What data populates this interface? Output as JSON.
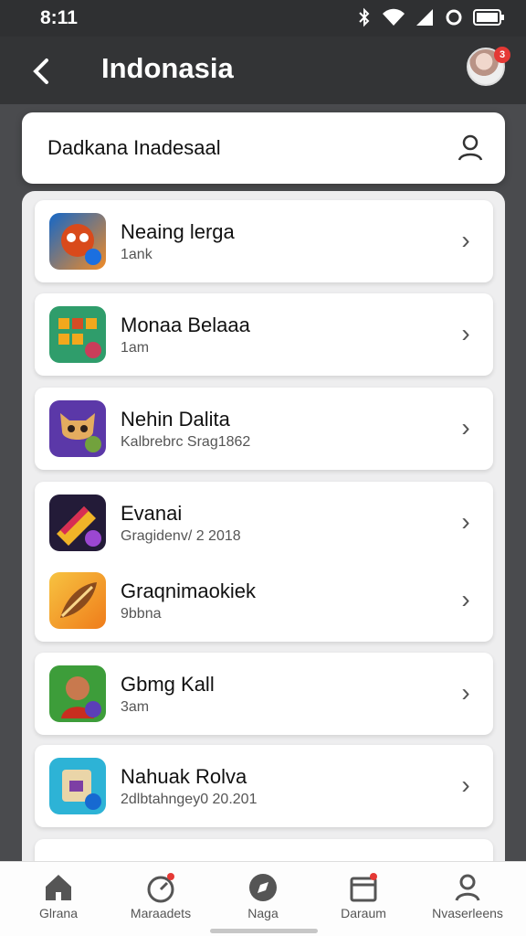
{
  "status_bar": {
    "time": "8:11"
  },
  "header": {
    "title": "Indonasia",
    "back_icon": "arrow-left-icon",
    "avatar_badge": "3"
  },
  "search": {
    "value": "Dadkana Inadesaal",
    "placeholder": "",
    "icon": "user-icon"
  },
  "apps": [
    {
      "name": "Neaing lerga",
      "subtitle": "1ank",
      "icon": "fox-character-icon"
    },
    {
      "name": "Monaa Belaaa",
      "subtitle": "1am",
      "icon": "block-game-icon"
    },
    {
      "name": "Nehin Dalita",
      "subtitle": "Kalbrebrc Srag1862",
      "icon": "cat-character-icon"
    },
    {
      "name": "Evanai",
      "subtitle": "Gragidenv/ 2 2018",
      "icon": "candy-game-icon"
    },
    {
      "name": "Graqnimaokiek",
      "subtitle": "9bbna",
      "icon": "feather-icon"
    },
    {
      "name": "Gbmg Kall",
      "subtitle": "3am",
      "icon": "warrior-character-icon"
    },
    {
      "name": "Nahuak Rolva",
      "subtitle": "2dlbtahngey0 20.201",
      "icon": "box-character-icon"
    }
  ],
  "bottom_nav": [
    {
      "label": "Glrana",
      "icon": "home-icon"
    },
    {
      "label": "Maraadets",
      "icon": "timer-icon"
    },
    {
      "label": "Naga",
      "icon": "compass-icon"
    },
    {
      "label": "Daraum",
      "icon": "calendar-icon"
    },
    {
      "label": "Nvaserleens",
      "icon": "profile-icon"
    }
  ],
  "colors": {
    "background": "#4a4b4e",
    "app_bar": "#333436",
    "badge_red": "#e53935",
    "card": "#ffffff"
  }
}
